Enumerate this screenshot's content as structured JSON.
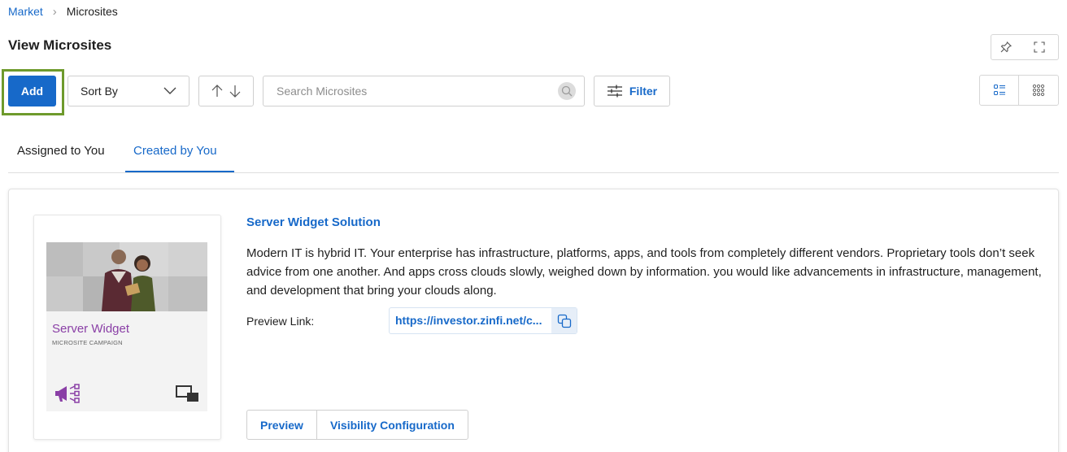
{
  "breadcrumb": {
    "parent": "Market",
    "current": "Microsites"
  },
  "page": {
    "title": "View Microsites"
  },
  "toolbar": {
    "add_label": "Add",
    "sort_label": "Sort By",
    "search_placeholder": "Search Microsites",
    "filter_label": "Filter"
  },
  "tabs": [
    {
      "label": "Assigned to You",
      "active": false
    },
    {
      "label": "Created by You",
      "active": true
    }
  ],
  "microsite": {
    "thumbnail": {
      "title": "Server Widget",
      "subtitle": "MICROSITE CAMPAIGN"
    },
    "title": "Server Widget Solution",
    "description": "Modern IT is hybrid IT. Your enterprise has infrastructure, platforms, apps, and tools from completely different vendors. Proprietary tools don’t seek advice from one another. And apps cross clouds slowly, weighed down by information. you would like advancements in infrastructure, management, and development that bring your clouds along.",
    "preview_label": "Preview Link:",
    "preview_link": "https://investor.zinfi.net/c...",
    "actions": {
      "preview": "Preview",
      "visibility": "Visibility Configuration"
    }
  },
  "colors": {
    "accent": "#1769c9",
    "highlight": "#6e9a2c",
    "thumb_title": "#8a3fa6"
  }
}
